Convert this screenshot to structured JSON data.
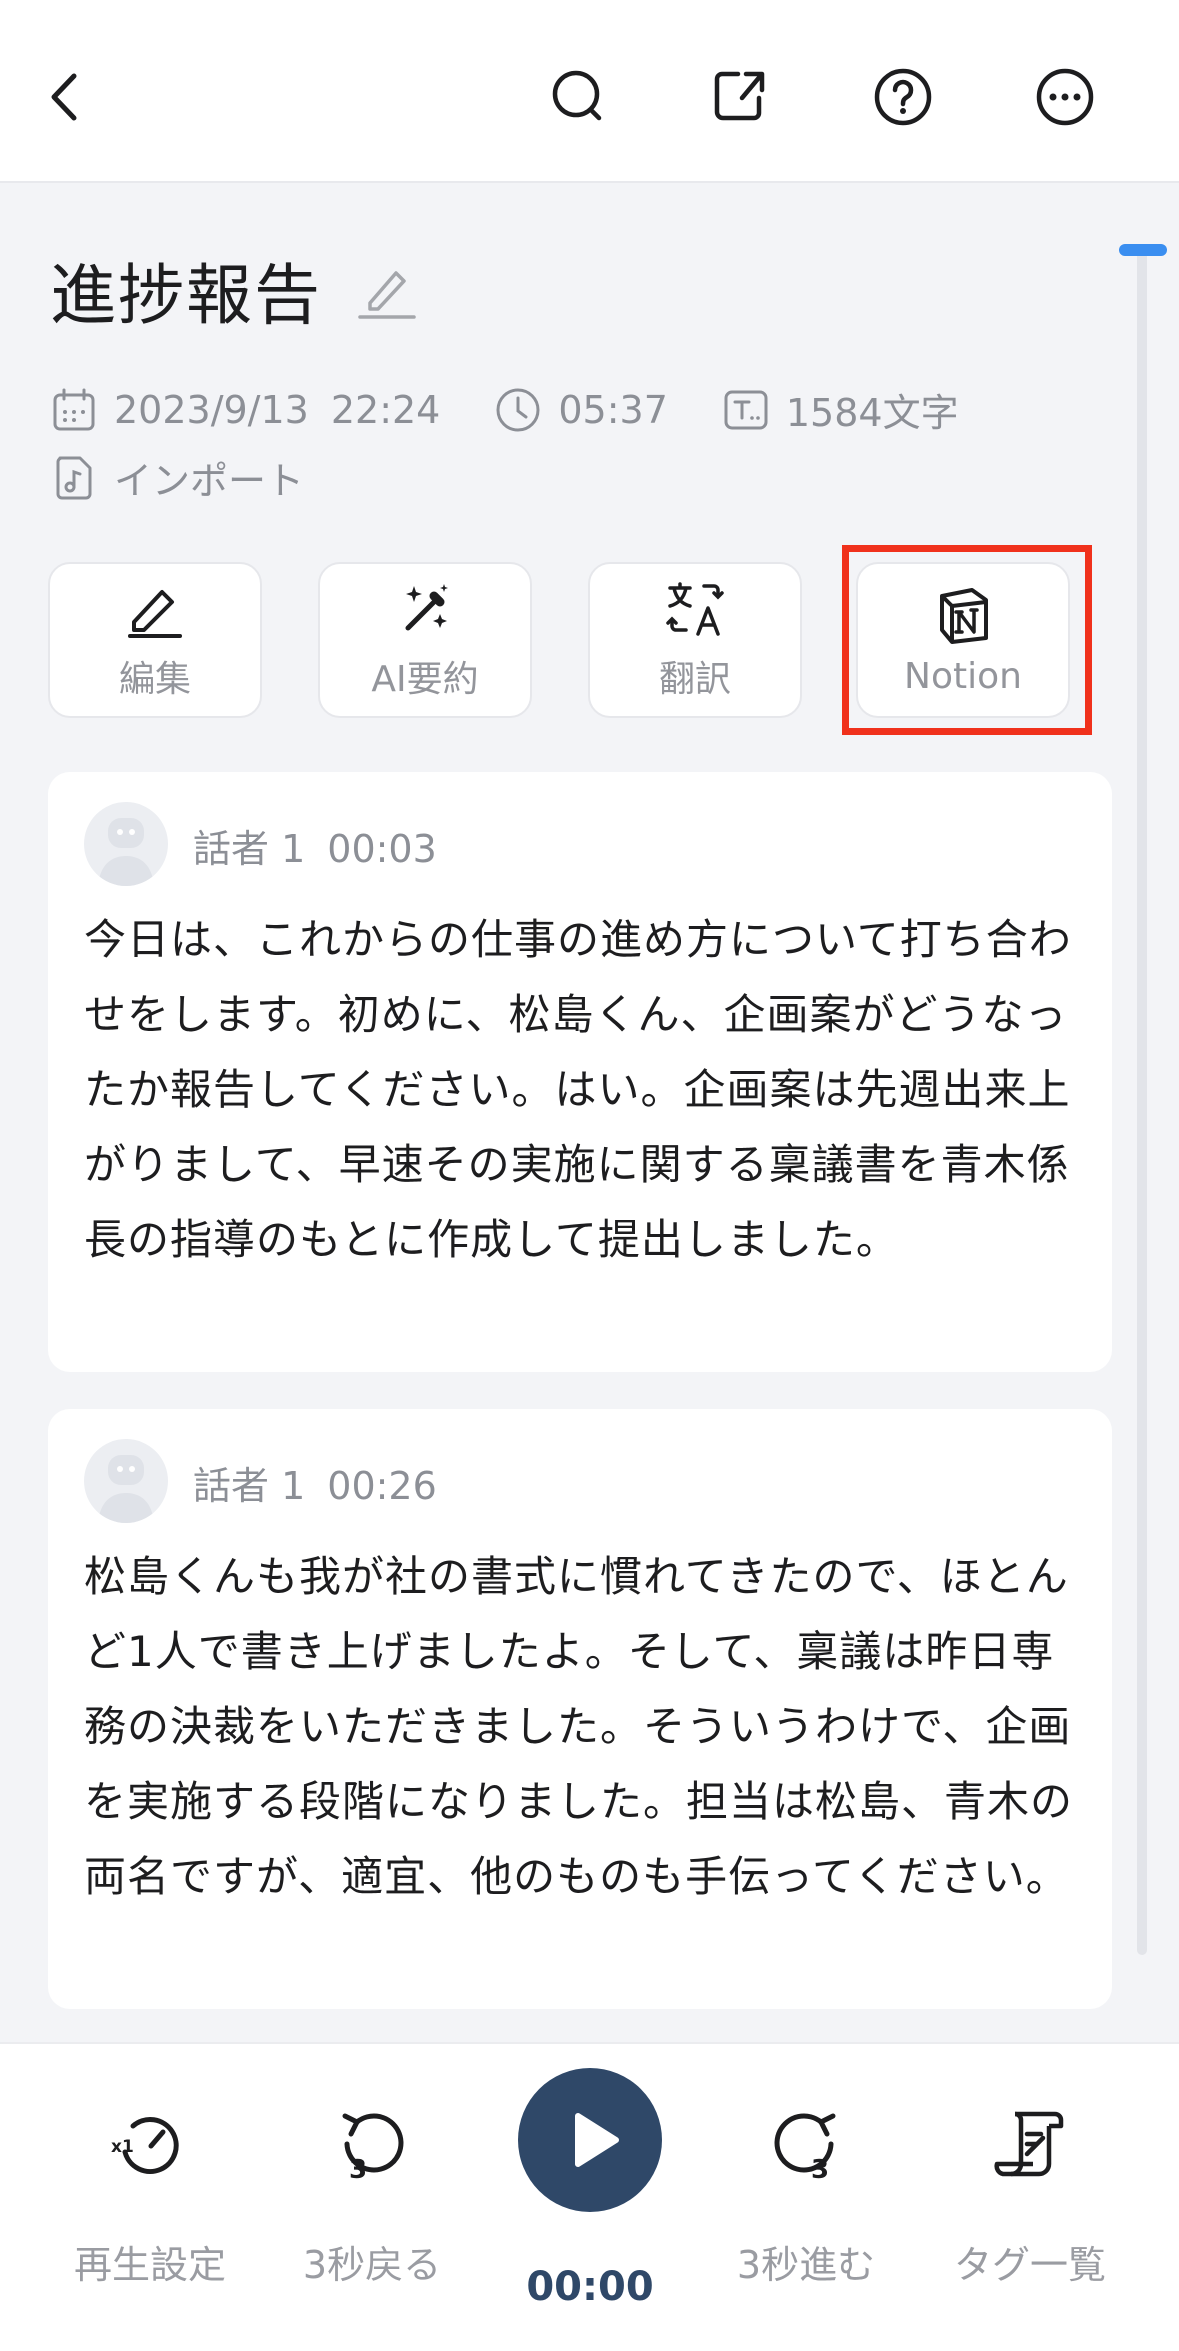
{
  "header": {
    "back_icon": "chevron-left-icon",
    "search_icon": "search-icon",
    "export_icon": "share-export-icon",
    "help_icon": "help-icon",
    "more_icon": "more-icon"
  },
  "title": "進捗報告",
  "meta": {
    "date": "2023/9/13",
    "time": "22:24",
    "duration": "05:37",
    "char_count": "1584文字",
    "source": "インポート"
  },
  "actions": [
    {
      "label": "編集",
      "icon": "pencil-icon"
    },
    {
      "label": "AI要約",
      "icon": "magic-wand-icon"
    },
    {
      "label": "翻訳",
      "icon": "translate-icon"
    },
    {
      "label": "Notion",
      "icon": "notion-icon"
    }
  ],
  "transcripts": [
    {
      "speaker": "話者 1",
      "timestamp": "00:03",
      "text": "今日は、これからの仕事の進め方について打ち合わせをします。初めに、松島くん、企画案がどうなったか報告してください。はい。企画案は先週出来上がりまして、早速その実施に関する稟議書を青木係長の指導のもとに作成して提出しました。"
    },
    {
      "speaker": "話者 1",
      "timestamp": "00:26",
      "text": "松島くんも我が社の書式に慣れてきたので、ほとんど1人で書き上げましたよ。そして、稟議は昨日専務の決裁をいただきました。そういうわけで、企画を実施する段階になりました。担当は松島、青木の両名ですが、適宜、他のものも手伝ってください。"
    }
  ],
  "player": {
    "speed_label": "再生設定",
    "speed_icon_text": "x1",
    "rewind_label": "3秒戻る",
    "rewind_icon_text": "3",
    "current_time": "00:00",
    "forward_label": "3秒進む",
    "forward_icon_text": "3",
    "tags_label": "タグ一覧"
  },
  "colors": {
    "accent": "#2f4868",
    "highlight": "#f0311c",
    "scroll": "#3a8ef0"
  }
}
